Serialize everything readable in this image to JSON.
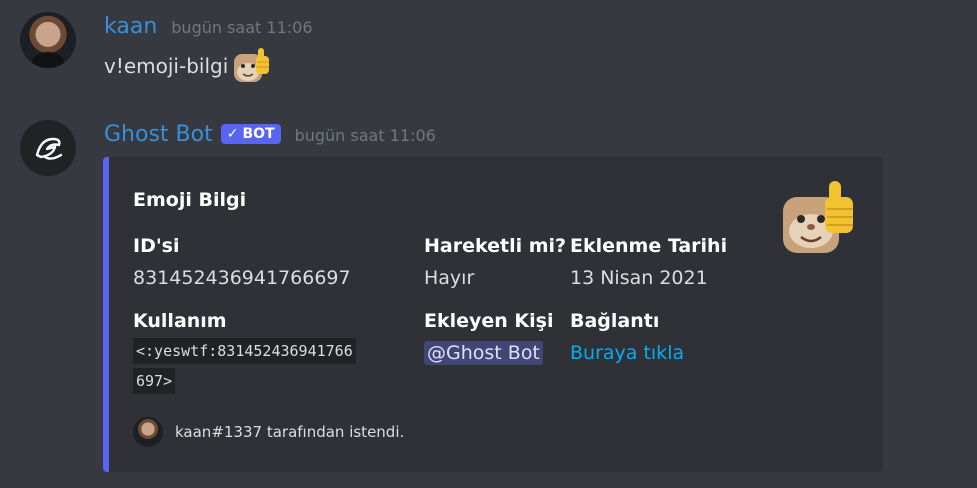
{
  "messages": [
    {
      "username": "kaan",
      "timestamp": "bugün saat 11:06",
      "content": "v!emoji-bilgi",
      "emoji": "cat-thumbs-up-emoji"
    },
    {
      "username": "Ghost Bot",
      "bot_tag": "BOT",
      "timestamp": "bugün saat 11:06"
    }
  ],
  "embed": {
    "title": "Emoji Bilgi",
    "accent_color": "#5865f2",
    "thumbnail": "cat-thumbs-up-emoji",
    "fields": {
      "id": {
        "name": "ID'si",
        "value": "831452436941766697"
      },
      "animated": {
        "name": "Hareketli mi?",
        "value": "Hayır"
      },
      "added_date": {
        "name": "Eklenme Tarihi",
        "value": "13 Nisan 2021"
      },
      "usage": {
        "name": "Kullanım",
        "value_line1": "<:yeswtf:831452436941766",
        "value_line2": "697>"
      },
      "added_by": {
        "name": "Ekleyen Kişi",
        "value": "@Ghost Bot"
      },
      "link": {
        "name": "Bağlantı",
        "value": "Buraya tıkla"
      }
    },
    "footer": {
      "text": "kaan#1337 tarafından istendi."
    }
  }
}
